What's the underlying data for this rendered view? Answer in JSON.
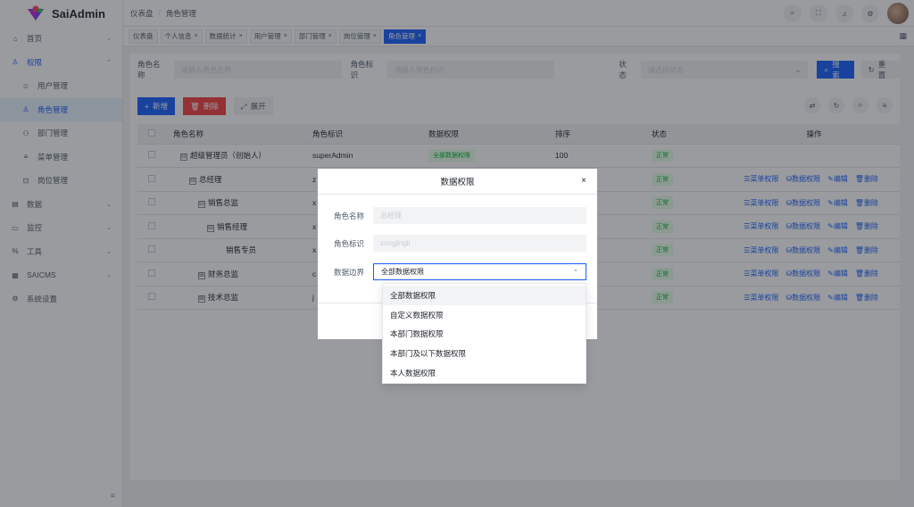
{
  "app": {
    "name": "SaiAdmin"
  },
  "breadcrumb": [
    "仪表盘",
    "角色管理"
  ],
  "header_tools": [
    "search-icon",
    "fullscreen-icon",
    "bell-icon",
    "gear-icon"
  ],
  "sidebar": {
    "items": [
      {
        "label": "首页",
        "icon": "home-icon",
        "glyph": "⌂",
        "chevron": "⌄"
      },
      {
        "label": "权限",
        "icon": "lock-icon",
        "glyph": "♙",
        "chevron": "⌃",
        "open": true
      },
      {
        "label": "用户管理",
        "icon": "user-icon",
        "glyph": "☺",
        "sub": true
      },
      {
        "label": "角色管理",
        "icon": "role-icon",
        "glyph": "♙",
        "sub": true,
        "active": true
      },
      {
        "label": "部门管理",
        "icon": "org-icon",
        "glyph": "⚇",
        "sub": true
      },
      {
        "label": "菜单管理",
        "icon": "menu-icon",
        "glyph": "≡",
        "sub": true
      },
      {
        "label": "岗位管理",
        "icon": "post-icon",
        "glyph": "⊡",
        "sub": true
      },
      {
        "label": "数据",
        "icon": "data-icon",
        "glyph": "▤",
        "chevron": "⌄"
      },
      {
        "label": "监控",
        "icon": "monitor-icon",
        "glyph": "▭",
        "chevron": "⌄"
      },
      {
        "label": "工具",
        "icon": "tool-icon",
        "glyph": "%",
        "chevron": "⌄"
      },
      {
        "label": "SAICMS",
        "icon": "cms-icon",
        "glyph": "▦",
        "chevron": "⌄"
      },
      {
        "label": "系统设置",
        "icon": "settings-icon",
        "glyph": "⚙"
      }
    ]
  },
  "tabs": [
    {
      "label": "仪表盘",
      "closable": false
    },
    {
      "label": "个人信息",
      "closable": true
    },
    {
      "label": "数据统计",
      "closable": true
    },
    {
      "label": "用户管理",
      "closable": true
    },
    {
      "label": "部门管理",
      "closable": true
    },
    {
      "label": "岗位管理",
      "closable": true
    },
    {
      "label": "角色管理",
      "closable": true,
      "active": true
    }
  ],
  "search": {
    "role_name_label": "角色名称",
    "role_name_placeholder": "请输入角色名称",
    "role_code_label": "角色标识",
    "role_code_placeholder": "请输入角色标识",
    "status_label": "状态",
    "status_placeholder": "请选择状态",
    "search_btn": "搜索",
    "reset_btn": "重置"
  },
  "toolbar": {
    "add": "新增",
    "delete": "删除",
    "expand": "展开"
  },
  "table": {
    "headers": [
      "角色名称",
      "角色标识",
      "数据权限",
      "排序",
      "状态",
      "操作"
    ],
    "rows": [
      {
        "name": "超级管理员（创始人）",
        "indent": 0,
        "expander": "⊟",
        "code": "superAdmin",
        "perm": "全部数据权限",
        "sort": "100",
        "status": "正常",
        "ops": false
      },
      {
        "name": "总经理",
        "indent": 1,
        "expander": "⊟",
        "code": "z",
        "perm": "",
        "sort": "",
        "status": "正常",
        "ops": true
      },
      {
        "name": "销售总监",
        "indent": 2,
        "expander": "⊟",
        "code": "x",
        "perm": "",
        "sort": "",
        "status": "正常",
        "ops": true
      },
      {
        "name": "销售经理",
        "indent": 3,
        "expander": "⊟",
        "code": "x",
        "perm": "",
        "sort": "",
        "status": "正常",
        "ops": true
      },
      {
        "name": "销售专员",
        "indent": 4,
        "expander": "",
        "code": "x",
        "perm": "",
        "sort": "",
        "status": "正常",
        "ops": true
      },
      {
        "name": "财务总监",
        "indent": 2,
        "expander": "⊞",
        "code": "c",
        "perm": "",
        "sort": "",
        "status": "正常",
        "ops": true
      },
      {
        "name": "技术总监",
        "indent": 2,
        "expander": "⊞",
        "code": "j",
        "perm": "",
        "sort": "",
        "status": "正常",
        "ops": true
      }
    ],
    "ops": [
      "菜单权限",
      "数据权限",
      "编辑",
      "删除"
    ]
  },
  "modal": {
    "title": "数据权限",
    "role_name_label": "角色名称",
    "role_name_value": "总经理",
    "role_code_label": "角色标识",
    "role_code_value": "zongjingli",
    "scope_label": "数据边界",
    "scope_value": "全部数据权限",
    "options": [
      "全部数据权限",
      "自定义数据权限",
      "本部门数据权限",
      "本部门及以下数据权限",
      "本人数据权限"
    ]
  }
}
